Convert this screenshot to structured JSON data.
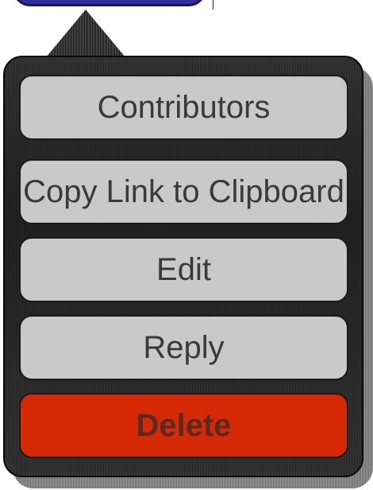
{
  "popover": {
    "items": [
      {
        "label": "Contributors",
        "kind": "normal"
      },
      {
        "label": "Copy Link to Clipboard",
        "kind": "normal"
      },
      {
        "label": "Edit",
        "kind": "normal"
      },
      {
        "label": "Reply",
        "kind": "normal"
      },
      {
        "label": "Delete",
        "kind": "danger"
      }
    ]
  },
  "colors": {
    "item_background": "#c9c9c9",
    "danger_background": "#d62a07",
    "popover_background": "#2a2a2a",
    "trigger_background": "#2f2f9a"
  }
}
